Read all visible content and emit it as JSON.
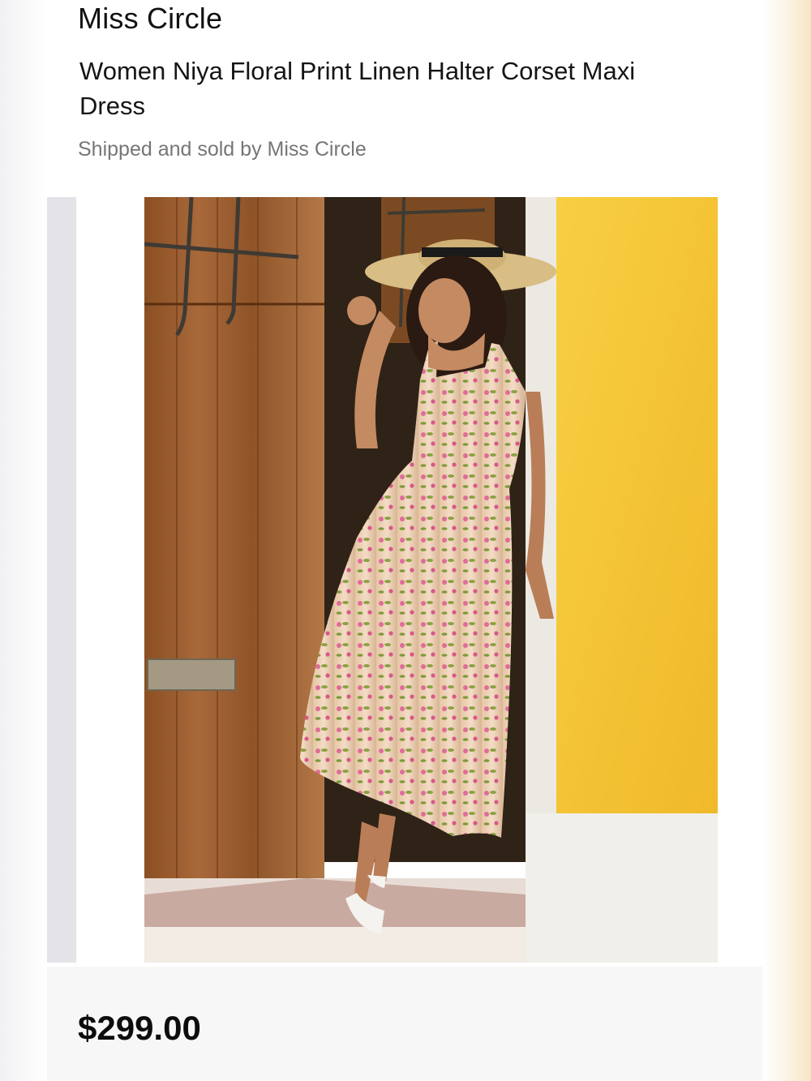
{
  "seller": {
    "name": "Miss Circle"
  },
  "product": {
    "title": "Women Niya Floral Print Linen Halter Corset Maxi Dress",
    "shipping_note": "Shipped and sold by Miss Circle",
    "price": "$299.00"
  },
  "gallery": {
    "image_description_icon": "photo",
    "colors": {
      "door_wood": "#9c5e2c",
      "yellow_wall": "#f6c636",
      "dress_base": "#efd3b8"
    }
  }
}
